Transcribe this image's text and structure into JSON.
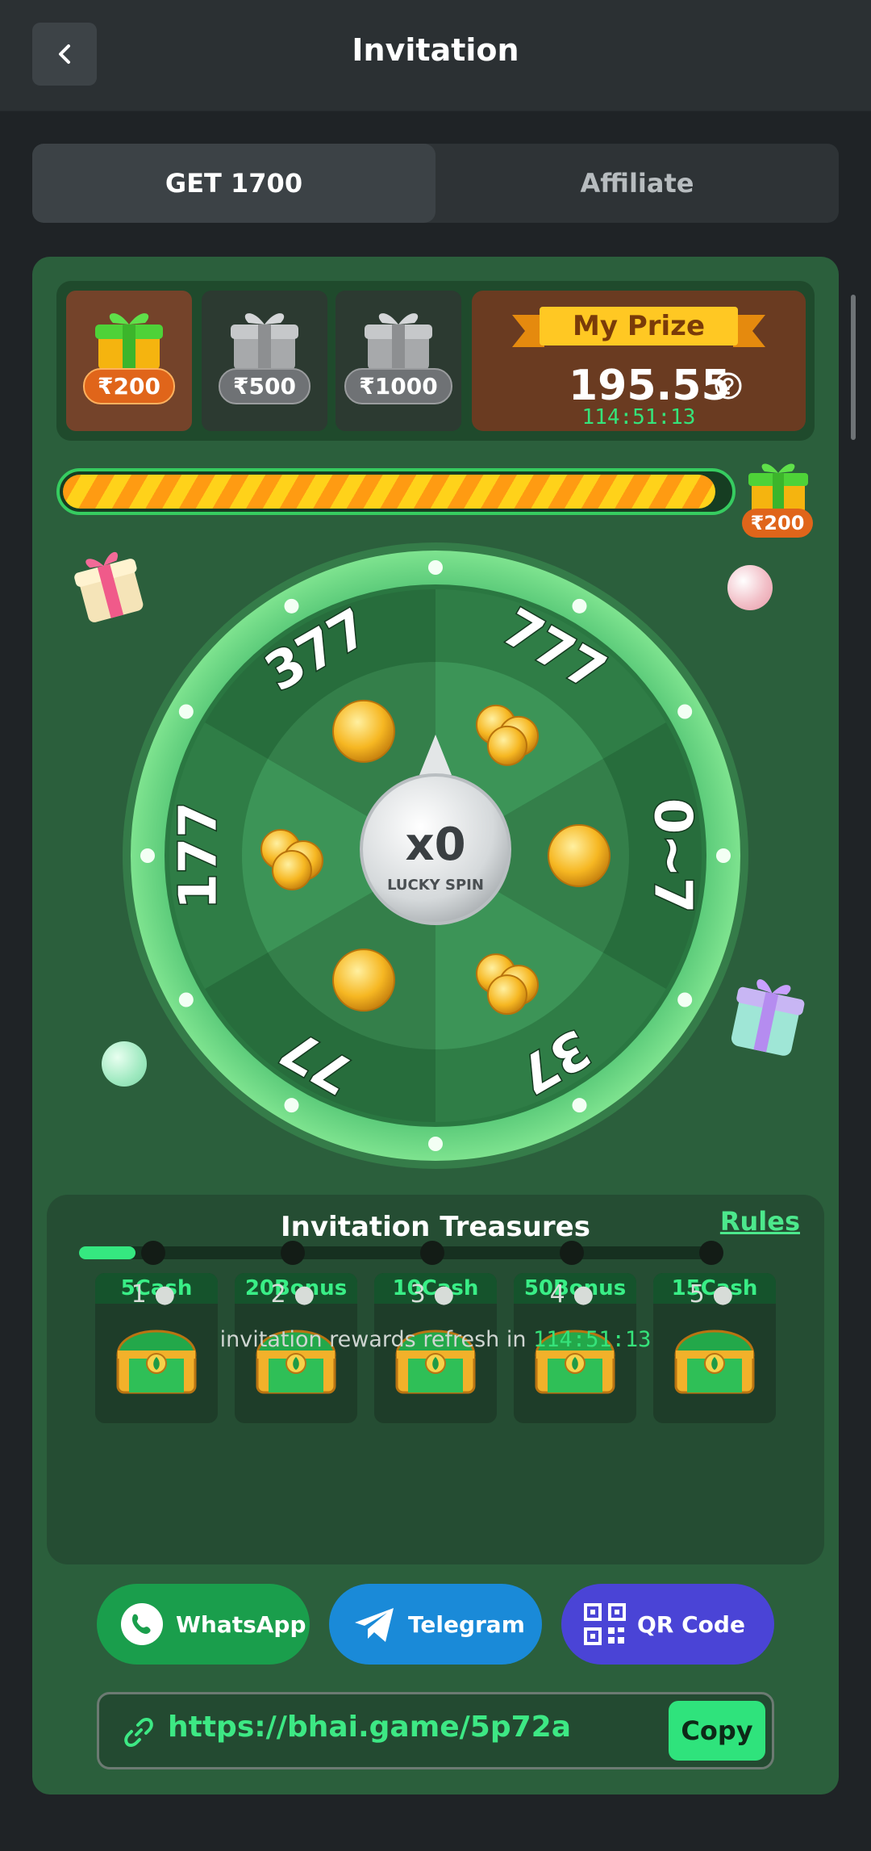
{
  "header": {
    "title": "Invitation"
  },
  "tabs": [
    {
      "label": "GET 1700",
      "active": true
    },
    {
      "label": "Affiliate",
      "active": false
    }
  ],
  "prize_boxes": [
    {
      "amount": "₹200",
      "unlocked": true
    },
    {
      "amount": "₹500",
      "unlocked": false
    },
    {
      "amount": "₹1000",
      "unlocked": false
    }
  ],
  "my_prize": {
    "label": "My Prize",
    "amount": "195.55",
    "timer": "114:51:13"
  },
  "progress": {
    "fraction": 0.98,
    "end_reward": "₹200"
  },
  "wheel": {
    "segments": [
      "777",
      "0~7",
      "37",
      "77",
      "177",
      "377"
    ],
    "multiplier": "x0",
    "center_label": "LUCKY SPIN"
  },
  "treasures": {
    "title": "Invitation Treasures",
    "rules_label": "Rules",
    "chests": [
      {
        "label": "5Cash",
        "step": "1"
      },
      {
        "label": "20Bonus",
        "step": "2"
      },
      {
        "label": "10Cash",
        "step": "3"
      },
      {
        "label": "50Bonus",
        "step": "4"
      },
      {
        "label": "15Cash",
        "step": "5"
      }
    ],
    "refresh_text": "invitation rewards refresh in",
    "refresh_time": "114:51:13"
  },
  "share": {
    "whatsapp": "WhatsApp",
    "telegram": "Telegram",
    "qrcode": "QR Code"
  },
  "invite_link": {
    "url": "https://bhai.game/5p72a",
    "copy_label": "Copy"
  },
  "colors": {
    "card_green": "#2b5f3c",
    "accent_green": "#35e37a",
    "whatsapp": "#1a9e4c",
    "telegram": "#1a8ad8",
    "qrcode": "#4a44d6"
  }
}
